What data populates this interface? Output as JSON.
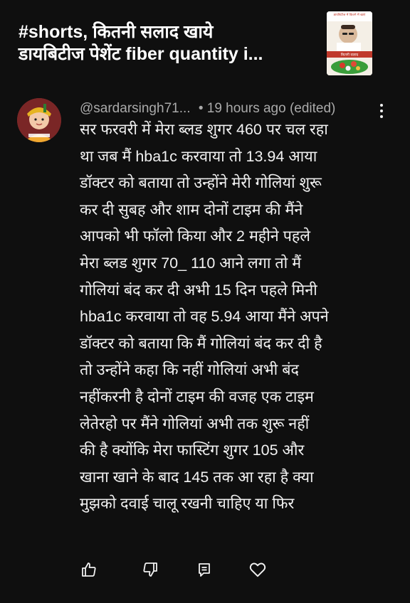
{
  "video": {
    "title": "#shorts, कितनी सलाद खाये\nडायबिटीज पेशेंट fiber quantity i...",
    "thumbnail": {
      "caption_top": "डायबिटीज में कितने में खाएं",
      "caption_bottom": "कितनी सलाद",
      "colors": {
        "background": "#f4efe6",
        "band": "#c0392b",
        "salad": "#3a9d3a"
      }
    }
  },
  "comment": {
    "author": "@sardarsingh71...",
    "time": "• 19 hours ago (edited)",
    "avatar_icon": "krishna-avatar-icon",
    "lines": [
      "सर फरवरी में मेरा ब्लड शुगर 460 पर चल रहा",
      "था जब मैं hba1c करवाया तो 13.94 आया",
      "डॉक्टर को बताया तो उन्होंने मेरी गोलियां शुरू",
      "कर दी सुबह और शाम दोनों टाइम की मैंने",
      "आपको भी फॉलो किया और 2 महीने पहले",
      "मेरा ब्लड शुगर 70_ 110 आने लगा तो मैं",
      "गोलियां बंद कर दी अभी 15 दिन पहले मिनी",
      "hba1c करवाया तो वह 5.94 आया मैंने अपने",
      "डॉक्टर को बताया कि मैं गोलियां बंद कर दी है",
      "तो उन्होंने कहा कि नहीं गोलियां अभी बंद",
      "नहींकरनी है दोनों टाइम की वजह एक टाइम",
      "लेतेरहो पर मैंने गोलियां अभी तक शुरू नहीं",
      "की है क्योंकि मेरा फास्टिंग शुगर 105 और",
      "खाना खाने के बाद 145 तक आ रहा है क्या",
      "मुझको दवाई चालू रखनी चाहिए या फिर"
    ],
    "actions": [
      {
        "name": "like-icon"
      },
      {
        "name": "dislike-icon"
      },
      {
        "name": "reply-icon"
      },
      {
        "name": "heart-icon"
      }
    ]
  },
  "colors": {
    "background": "#0f0f0f",
    "text_primary": "#f1f1f1",
    "text_secondary": "#aaaaaa"
  }
}
